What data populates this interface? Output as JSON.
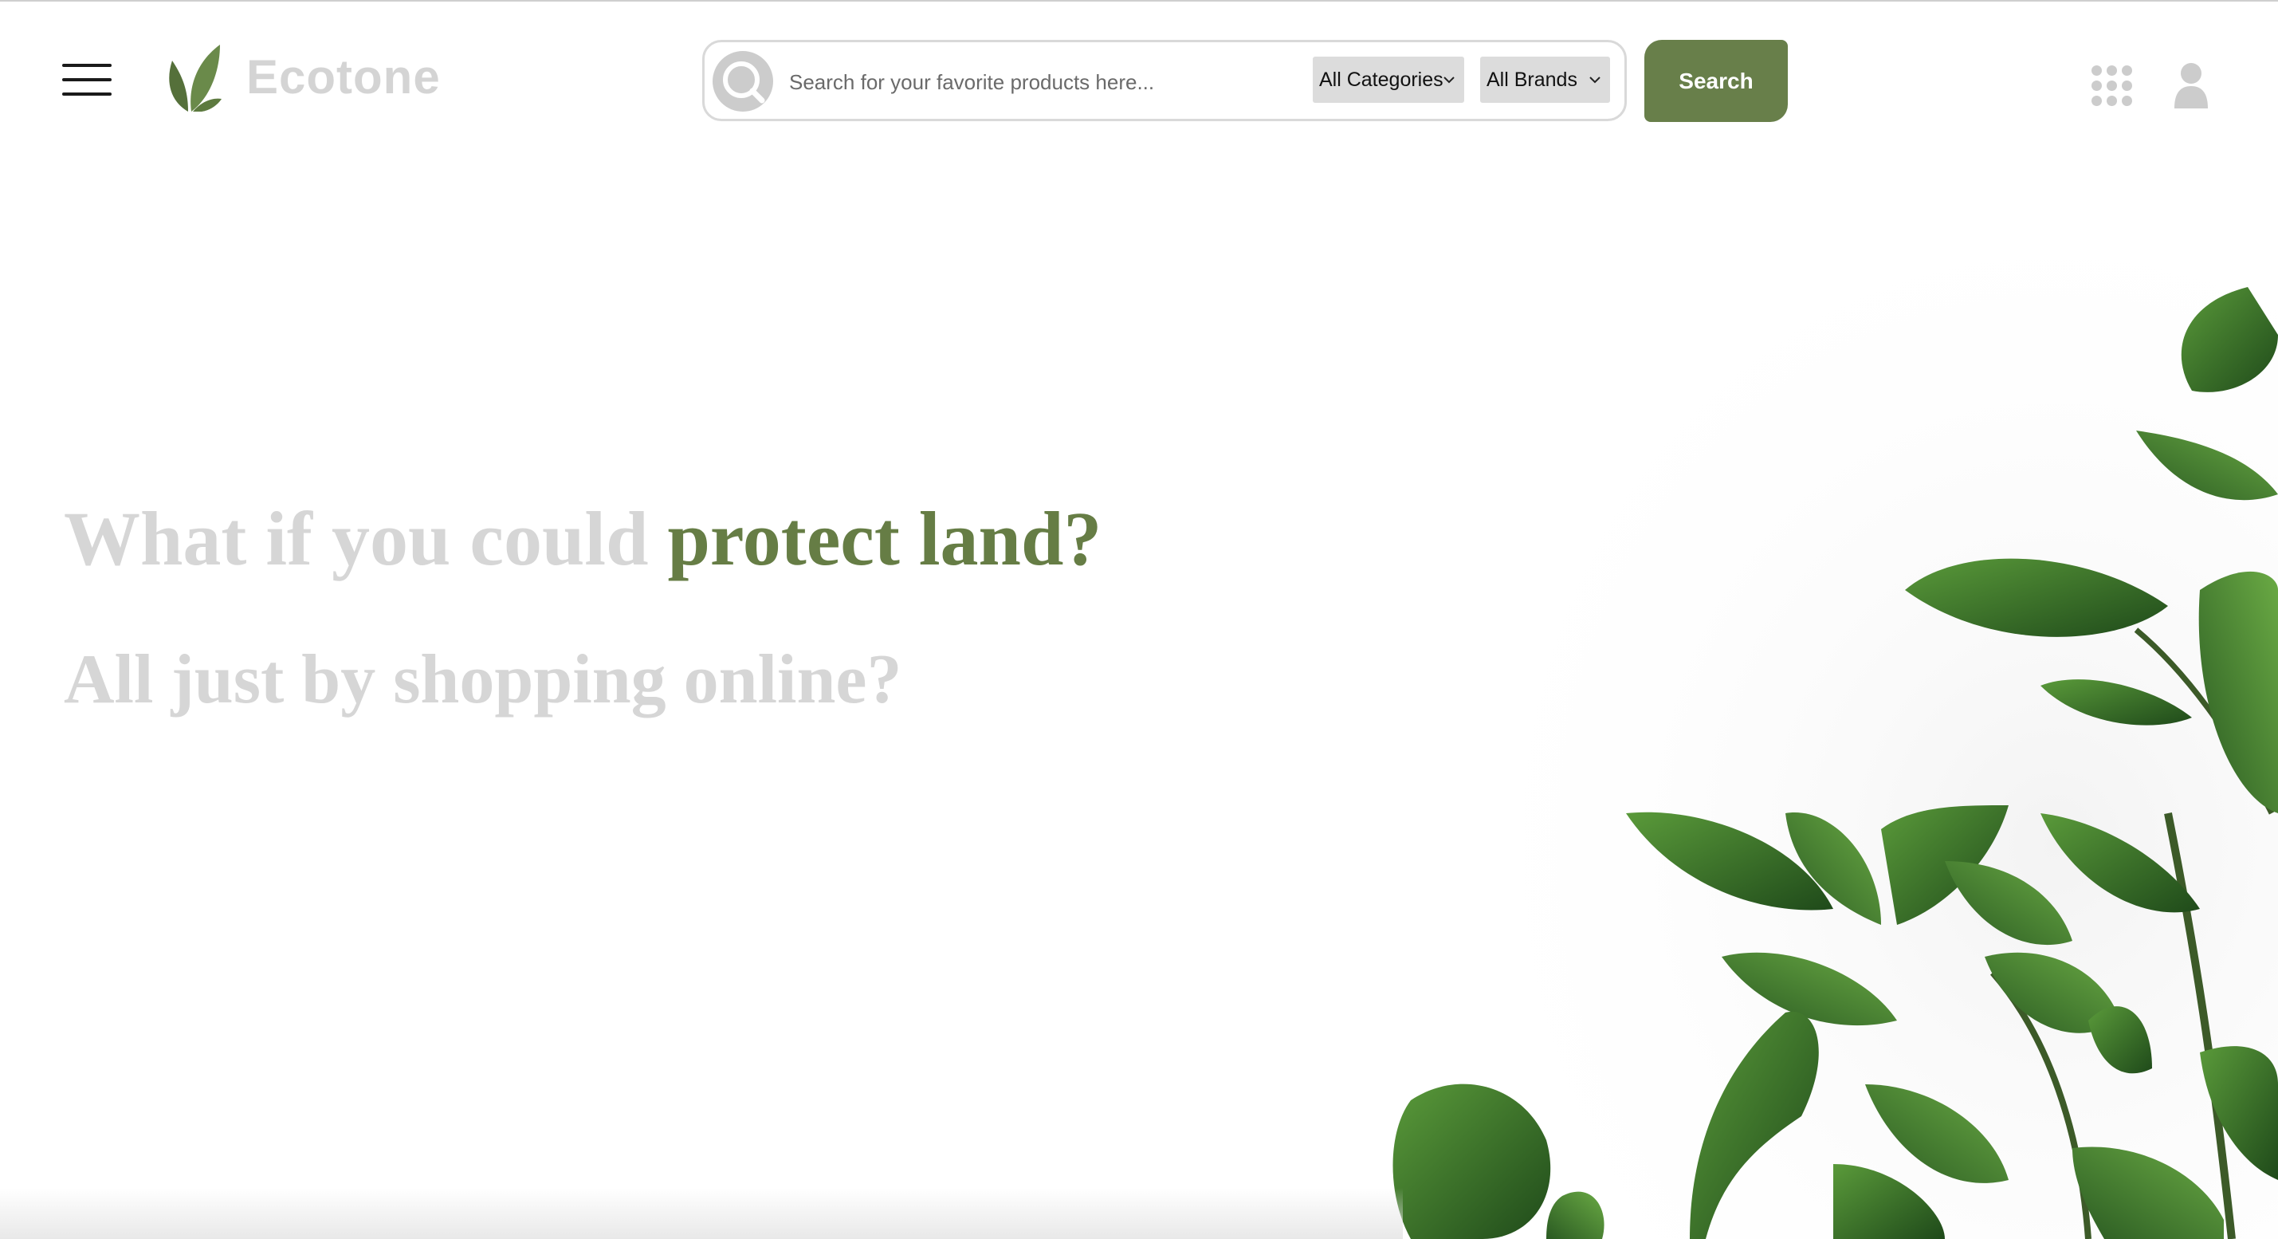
{
  "brand": {
    "name": "Ecotone",
    "logo_icon": "leaf-icon"
  },
  "header": {
    "menu_icon": "hamburger-menu-icon",
    "search": {
      "placeholder": "Search for your favorite products here...",
      "value": "",
      "icon": "search-icon",
      "category_selected": "All Categories",
      "brand_selected": "All Brands",
      "button_label": "Search"
    },
    "apps_icon": "apps-grid-icon",
    "user_icon": "user-icon"
  },
  "hero": {
    "line1_prefix": "What if you could ",
    "line1_accent": "protect land?",
    "line2": "All just by shopping online?"
  },
  "colors": {
    "accent": "#687f4a",
    "muted_text": "#d6d6d6",
    "select_bg": "#dcdcdc",
    "icon_gray": "#cccccc"
  }
}
